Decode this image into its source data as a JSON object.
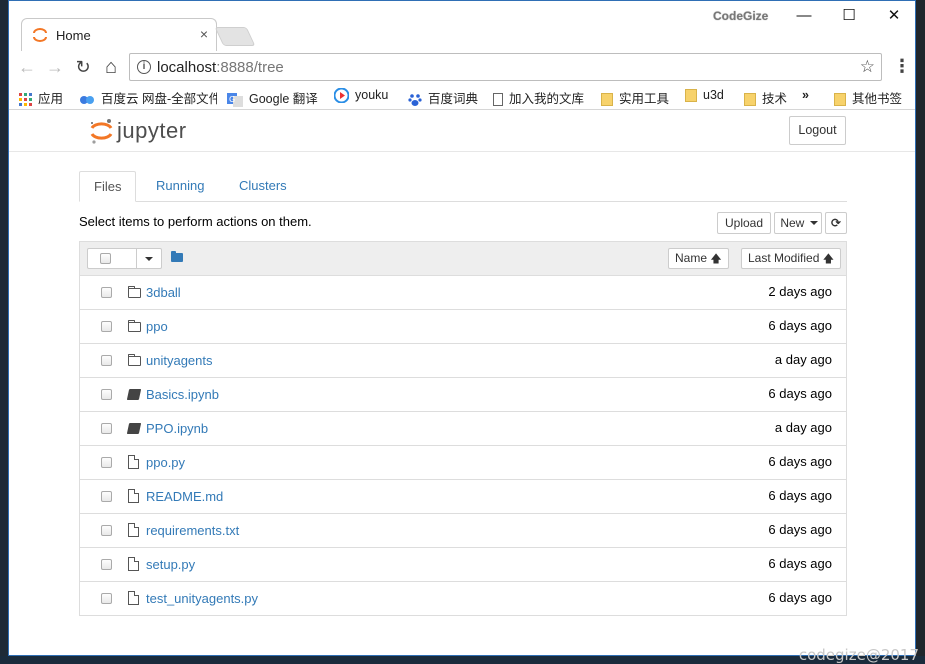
{
  "desktop": {
    "watermark": "codegize@2017"
  },
  "browser": {
    "tab": {
      "title": "Home",
      "close_glyph": "×"
    },
    "brand_text": "CodeGize",
    "window_buttons": {
      "minimize": "—",
      "maximize": "☐",
      "close": "✕"
    },
    "nav": {
      "back": "←",
      "forward": "→",
      "reload": "↻",
      "home": "⌂"
    },
    "url": {
      "host": "localhost",
      "path": ":8888/tree"
    },
    "bookmarks": [
      {
        "label": "应用",
        "icon": "apps-grid-icon"
      },
      {
        "label": "百度云 网盘-全部文件",
        "icon": "baidu-cloud-icon"
      },
      {
        "label": "Google 翻译",
        "icon": "google-translate-icon"
      },
      {
        "label": "youku",
        "icon": "youku-icon"
      },
      {
        "label": "百度词典",
        "icon": "baidu-paw-icon"
      },
      {
        "label": "加入我的文库",
        "icon": "page-icon"
      },
      {
        "label": "实用工具",
        "icon": "folder-icon"
      },
      {
        "label": "u3d",
        "icon": "folder-icon"
      },
      {
        "label": "技术",
        "icon": "folder-icon"
      },
      {
        "label": "»",
        "icon": ""
      },
      {
        "label": "其他书签",
        "icon": "folder-icon"
      }
    ]
  },
  "jupyter": {
    "logo_text": "jupyter",
    "logout_label": "Logout",
    "tabs": [
      "Files",
      "Running",
      "Clusters"
    ],
    "hint": "Select items to perform actions on them.",
    "buttons": {
      "upload": "Upload",
      "new": "New",
      "refresh": "⟳"
    },
    "sort": {
      "name": "Name",
      "last_modified": "Last Modified",
      "arrow": "🡅"
    },
    "files": [
      {
        "name": "3dball",
        "type": "folder",
        "modified": "2 days ago"
      },
      {
        "name": "ppo",
        "type": "folder",
        "modified": "6 days ago"
      },
      {
        "name": "unityagents",
        "type": "folder",
        "modified": "a day ago"
      },
      {
        "name": "Basics.ipynb",
        "type": "notebook",
        "modified": "6 days ago"
      },
      {
        "name": "PPO.ipynb",
        "type": "notebook",
        "modified": "a day ago"
      },
      {
        "name": "ppo.py",
        "type": "file",
        "modified": "6 days ago"
      },
      {
        "name": "README.md",
        "type": "file",
        "modified": "6 days ago"
      },
      {
        "name": "requirements.txt",
        "type": "file",
        "modified": "6 days ago"
      },
      {
        "name": "setup.py",
        "type": "file",
        "modified": "6 days ago"
      },
      {
        "name": "test_unityagents.py",
        "type": "file",
        "modified": "6 days ago"
      }
    ],
    "colors": {
      "link": "#337ab7",
      "logo_orange": "#f37726"
    }
  }
}
